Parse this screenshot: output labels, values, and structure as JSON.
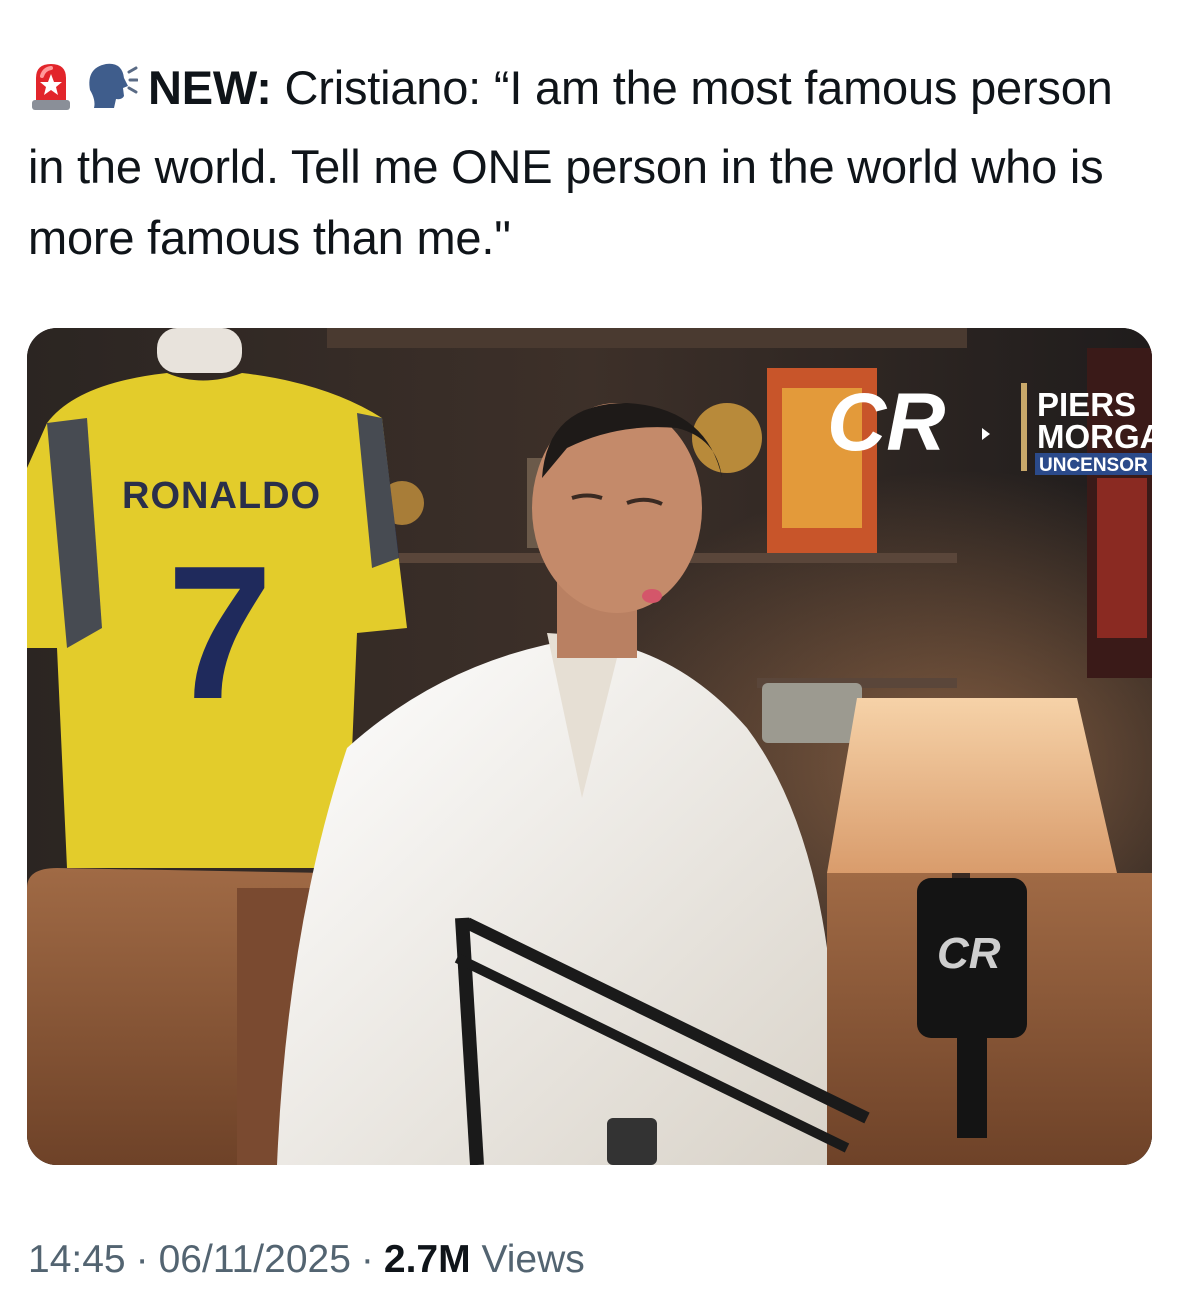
{
  "tweet": {
    "emojis": [
      "rotating-light-icon",
      "speaking-head-icon"
    ],
    "label": "NEW",
    "label_suffix": ":",
    "text_after_label": " Cristiano: “I am the most famous person in the world. Tell me ONE person in the world who is more famous than me.\""
  },
  "media": {
    "jersey_name": "RONALDO",
    "jersey_number": "7",
    "overlay_brand": {
      "line1": "PIERS",
      "line2": "MORGA",
      "line3": "UNCENSOR"
    },
    "colors": {
      "jersey_yellow": "#e3cc2b",
      "jersey_navy": "#1f2a5c",
      "sofa_brown": "#8a5a3a",
      "shirt_white": "#f3f0ea",
      "lamp_shade": "#f0c79a"
    }
  },
  "meta": {
    "time": "14:45",
    "date": "06/11/2025",
    "views_count": "2.7M",
    "views_label": "Views",
    "separator": "·"
  }
}
